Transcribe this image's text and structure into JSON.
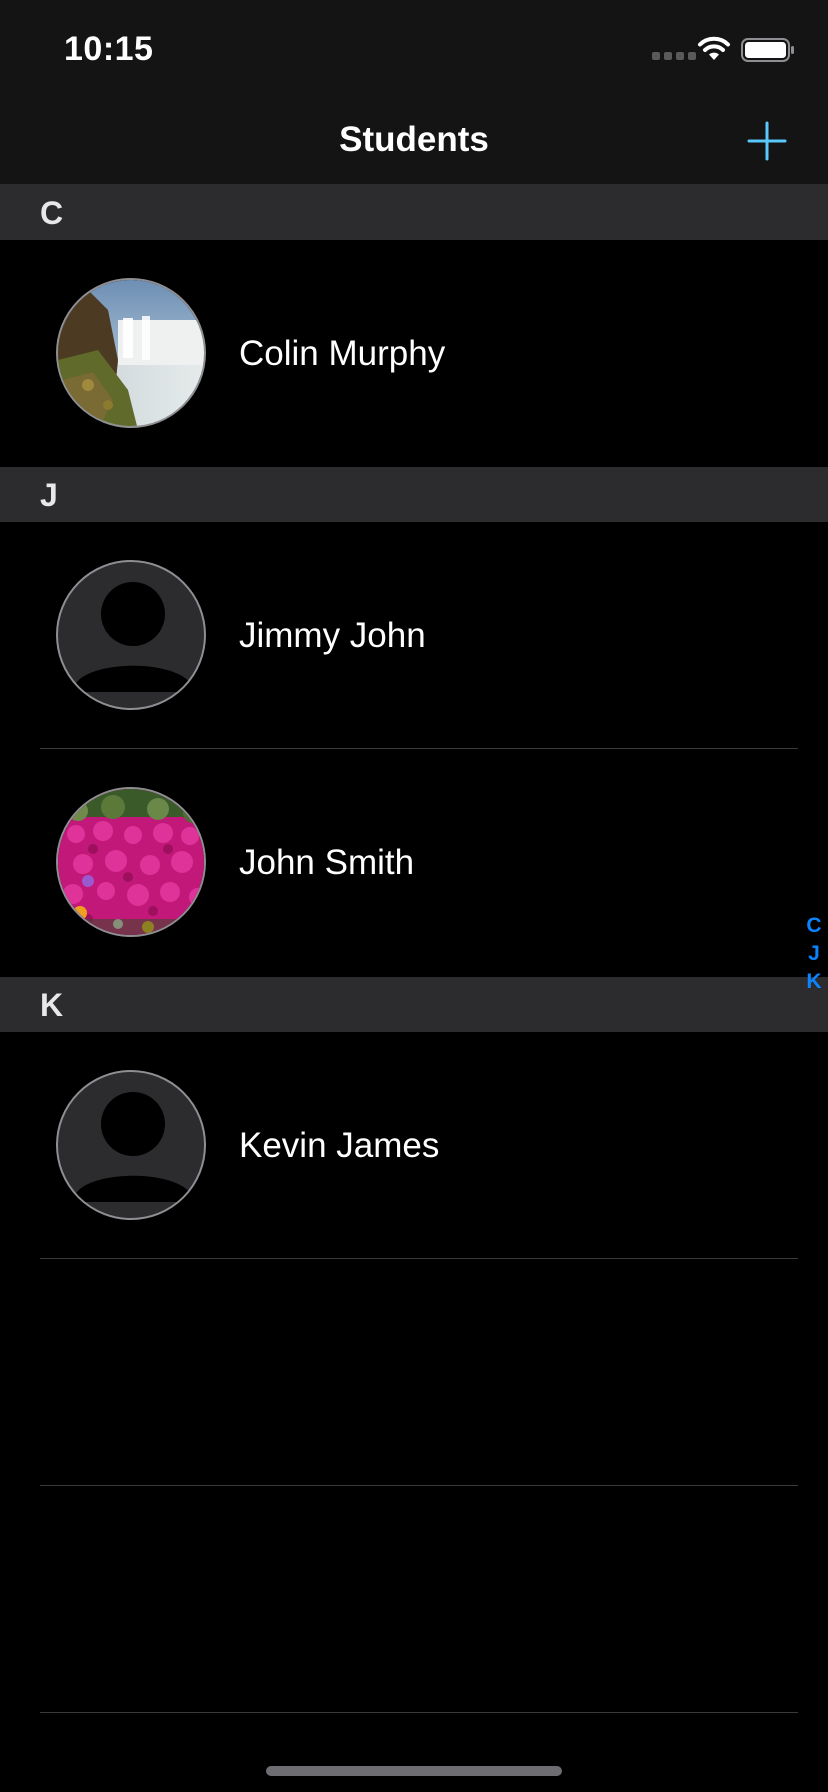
{
  "status_bar": {
    "time": "10:15",
    "icons": [
      "signal-icon",
      "wifi-icon",
      "battery-icon"
    ]
  },
  "nav": {
    "title": "Students",
    "add_icon": "plus-icon",
    "accent_color": "#0a84ff"
  },
  "sections": [
    {
      "letter": "C",
      "students": [
        {
          "name": "Colin Murphy",
          "avatar": "waterfall-photo"
        }
      ]
    },
    {
      "letter": "J",
      "students": [
        {
          "name": "Jimmy John",
          "avatar": "default-person-icon"
        },
        {
          "name": "John Smith",
          "avatar": "flowers-photo"
        }
      ]
    },
    {
      "letter": "K",
      "students": [
        {
          "name": "Kevin James",
          "avatar": "default-person-icon"
        }
      ]
    }
  ],
  "index": [
    "C",
    "J",
    "K"
  ]
}
